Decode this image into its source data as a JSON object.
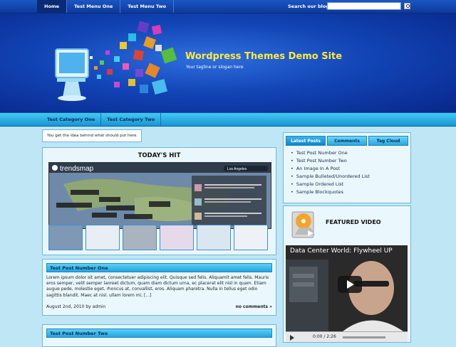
{
  "topnav": {
    "items": [
      {
        "label": "Home",
        "active": true
      },
      {
        "label": "Test Menu One",
        "active": false
      },
      {
        "label": "Test Menu Two",
        "active": false
      }
    ],
    "search_label": "Search our blog",
    "search_value": ""
  },
  "header": {
    "site_title": "Wordpress Themes Demo Site",
    "tagline": "Your tagline or slogan here"
  },
  "catnav": {
    "items": [
      {
        "label": "Test Category One"
      },
      {
        "label": "Test Category Two"
      }
    ]
  },
  "main": {
    "notice": "You get the idea behind what should put here.",
    "hit": {
      "title": "TODAY'S HIT",
      "screenshot_text": [
        "trendsmap",
        "Los Angeles"
      ]
    },
    "posts": [
      {
        "title": "Test Post Number One",
        "excerpt": "Lorem ipsum dolor sit amet, consectetuer adipiscing elit. Quisque sed felis. Aliquamit amet felis. Mauris eros semper, velit semper laoreet dictum, quam diam dictum urna, ec placerat elit nisl in quam. Etiam augue pede, molestie eget, rhoncus at, convallist, eros. Aliquam pharetra. Nulla in tellus eget odio sagittis blandit. Maec at nisl. ullam lorem mi, [...]",
        "date": "August 2nd, 2010 by admin",
        "comments": "no comments »"
      },
      {
        "title": "Test Post Number Two"
      }
    ]
  },
  "sidebar": {
    "tabs": [
      {
        "label": "Latest Posts",
        "active": true
      },
      {
        "label": "Comments",
        "active": false
      },
      {
        "label": "Tag Cloud",
        "active": false
      }
    ],
    "latest_posts": [
      "Test Post Number One",
      "Test Post Number Two",
      "An Image In A Post",
      "Sample Bulleted/Unordered List",
      "Sample Ordered List",
      "Sample Blockquotes"
    ],
    "featured_video": {
      "heading": "FEATURED VIDEO",
      "video_title": "Data Center World: Flywheel UP",
      "time": "0:00 / 2:26"
    }
  }
}
